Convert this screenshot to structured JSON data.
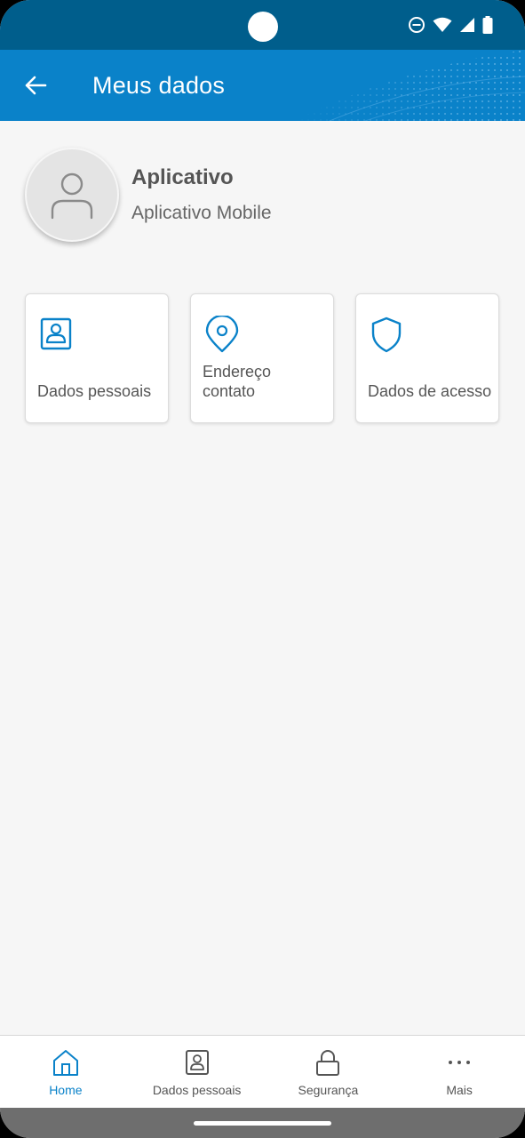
{
  "header": {
    "title": "Meus dados",
    "back_icon": "arrow-left-icon"
  },
  "status_bar": {
    "icons": [
      "do-not-disturb-icon",
      "wifi-icon",
      "signal-icon",
      "battery-icon"
    ]
  },
  "profile": {
    "avatar_icon": "user-icon",
    "name": "Aplicativo",
    "subtitle": "Aplicativo Mobile"
  },
  "cards": [
    {
      "label": "Dados pessoais",
      "icon": "id-badge-icon"
    },
    {
      "label": "Endereço contato",
      "icon": "location-pin-icon"
    },
    {
      "label": "Dados de acesso",
      "icon": "shield-icon"
    }
  ],
  "bottom_nav": {
    "items": [
      {
        "label": "Home",
        "icon": "home-icon",
        "active": true
      },
      {
        "label": "Dados pessoais",
        "icon": "id-badge-icon",
        "active": false
      },
      {
        "label": "Segurança",
        "icon": "lock-icon",
        "active": false
      },
      {
        "label": "Mais",
        "icon": "more-icon",
        "active": false
      }
    ]
  },
  "colors": {
    "status_bar": "#005e8c",
    "app_bar": "#0a82c9",
    "accent": "#0a82c9",
    "background": "#f6f6f6",
    "text": "#555555"
  }
}
